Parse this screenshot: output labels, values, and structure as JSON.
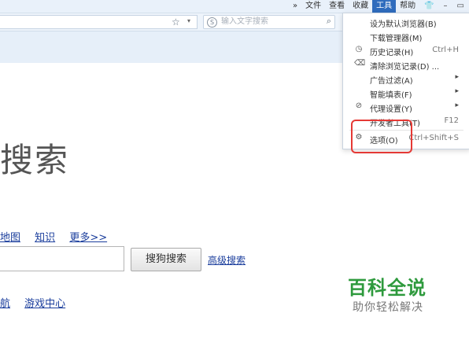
{
  "menubar": {
    "overflow": "»",
    "items": [
      "文件",
      "查看",
      "收藏",
      "工具",
      "帮助"
    ],
    "active": "工具"
  },
  "window_controls": {
    "skin": "👕",
    "minimize": "–",
    "restore": "▭"
  },
  "toolbar": {
    "star": "☆",
    "dropdown": "▾"
  },
  "search": {
    "logo": "S",
    "placeholder": "输入文字搜索",
    "magnifier": "⌕"
  },
  "page": {
    "title": "搜索",
    "links": [
      "地图",
      "知识",
      "更多>>"
    ],
    "search_button": "搜狗搜索",
    "advanced_link": "高级搜索",
    "bottom_links": [
      "航",
      "游戏中心"
    ]
  },
  "tools_menu": {
    "items": [
      {
        "label": "设为默认浏览器(B)",
        "icon": "",
        "shortcut": "",
        "submenu": false
      },
      {
        "label": "下载管理器(M)",
        "icon": "",
        "shortcut": "",
        "submenu": false
      },
      {
        "label": "历史记录(H)",
        "icon": "history-icon",
        "icon_glyph": "◷",
        "shortcut": "Ctrl+H",
        "submenu": false
      },
      {
        "label": "清除浏览记录(D) ...",
        "icon": "eraser-icon",
        "icon_glyph": "⌫",
        "shortcut": "",
        "submenu": false
      },
      {
        "label": "广告过滤(A)",
        "icon": "",
        "shortcut": "",
        "submenu": true
      },
      {
        "label": "智能填表(F)",
        "icon": "",
        "shortcut": "",
        "submenu": true
      },
      {
        "label": "代理设置(Y)",
        "icon": "link-icon",
        "icon_glyph": "⊘",
        "shortcut": "",
        "submenu": true
      },
      {
        "label": "开发者工具(T)",
        "icon": "",
        "shortcut": "F12",
        "submenu": false
      },
      {
        "label": "选项(O)",
        "icon": "gear-icon",
        "icon_glyph": "⚙",
        "shortcut": "Ctrl+Shift+S",
        "submenu": false
      }
    ],
    "submenu_arrow": "▸",
    "highlighted_item": "选项(O)"
  },
  "watermark": {
    "main": "百科全说",
    "sub": "助你轻松解决"
  },
  "colors": {
    "accent": "#2f6cbd",
    "highlight": "#e53935",
    "link": "#1a3d9c",
    "watermark": "#2e9a3d"
  }
}
